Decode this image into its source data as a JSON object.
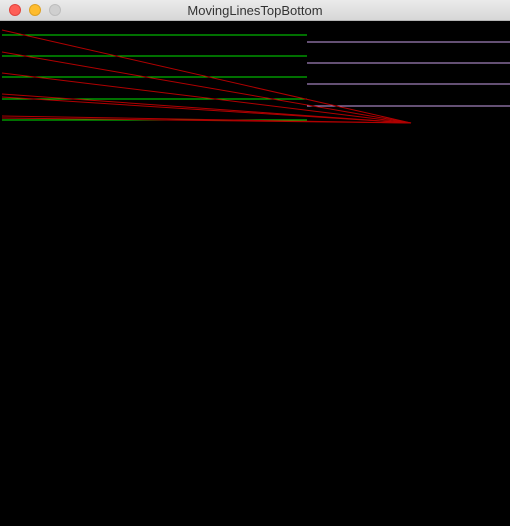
{
  "window": {
    "title": "MovingLinesTopBottom"
  },
  "canvas": {
    "background": "#000000",
    "colors": {
      "green_lines": "#00e000",
      "lavender_lines": "#c8a0e8",
      "red_lines": "#b00000"
    }
  }
}
